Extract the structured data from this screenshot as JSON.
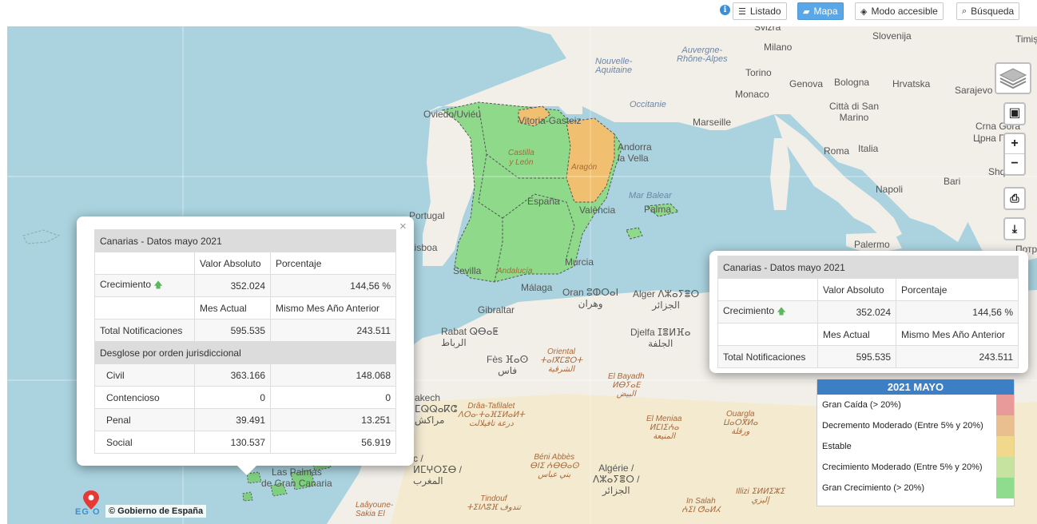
{
  "toolbar": {
    "info_glyph": "i",
    "listado": "Listado",
    "mapa": "Mapa",
    "modo_accesible": "Modo accesible",
    "busqueda": "Búsqueda"
  },
  "map_labels": {
    "suiza": "Svizra",
    "milano": "Milano",
    "slovenija": "Slovenija",
    "timisoara": "Timiș",
    "auvergne": "Auvergne-\nRhône-Alpes",
    "nouvelle": "Nouvelle-\nAquitaine",
    "torino": "Torino",
    "genova": "Genova",
    "bologna": "Bologna",
    "hrvatska": "Hrvatska",
    "sarajevo": "Sarajevo",
    "monaco": "Monaco",
    "occitanie": "Occitanie",
    "marseille": "Marseille",
    "citta_sm": "Città di San\nMarino",
    "crna_gora": "Crna Gora",
    "crna_cyr": "Црна Го",
    "oviedo": "Oviedo/Uviéu",
    "vitoria": "Vitoria-Gasteiz",
    "andorra": "Andorra\nla Vella",
    "roma": "Roma",
    "italia": "Italia",
    "castilla": "Castilla\ny León",
    "aragon": "Aragón",
    "bari": "Bari",
    "shqiperia": "Shqi",
    "napoli": "Napoli",
    "portugal": "Portugal",
    "espana": "España",
    "valencia": "València",
    "mar_balear": "Mar Balear",
    "palma": "Palma",
    "lisboa": "Lisboa",
    "palermo": "Palermo",
    "potpo": "Потро",
    "sevilla": "Sevilla",
    "andalucia": "Andalucía",
    "murcia": "Murcia",
    "malaga": "Málaga",
    "oran": "Oran ⵓⵀⵔⴰⵏ\nوهران",
    "alger": "Alger ⴷⵣⴰⵢⴻⵔ\nالجزائر",
    "gibraltar": "Gibraltar",
    "rabat": "Rabat ⵕⴱⴰⵟ\nالرباط",
    "djelfa": "Djelfa ⵊⴻⵍⴼⴰ\nالجلفة",
    "fes": "Fès ⴼⴰⵙ\nفاس",
    "oriental": "Oriental\nⵜⴰⵏⴳⵎⵓⵔⵜ\nالشرقية",
    "el_bayadh": "El Bayadh\nⵍⴱⵢⴰⴹ\nالبيض",
    "marrakech": "akech\nⵎⵕⵕⴰⴽⵛ\nمراكش",
    "draa": "Drâa-Tafilalet\nⴷⵔⴰ-ⵜⴰⴼⵉⵍⴰⵍⵜ\nدرعة تافيلالت",
    "el_meniaa": "El Meniaa\nⵍⵎⵏⵉⵄⴰ\nالمنيعة",
    "ouargla": "Ouargla\nⵡⴰⵔⴳⵍⴰ\nورقلة",
    "maroc": "c /\nⵍⵎⵖⵔⵉⴱ /\nالمغرب",
    "beni_abbes": "Béni Abbès\nⴱⵏⵉ ⵄⴱⴱⴰⵙ\nبني عباس",
    "algerie": "Algérie /\nⴷⵣⴰⵢⴻⵔ /\nالجزائر",
    "las_palmas": "Las Palmas\nde Gran Canaria",
    "tindouf": "Tindouf\nⵜⵉⵏⴷⵓⴼ تندوف",
    "illizi": "Illizi ⵉⵍⵍⵉⵣⵉ\nإليزي",
    "laayoune": "Laâyoune-\nSakia El",
    "in_salah": "In Salah\nⵄⵉⵏ ⵚⴰⵍⵃ"
  },
  "popup_left": {
    "title": "Canarias - Datos mayo 2021",
    "col_valor": "Valor Absoluto",
    "col_porcentaje": "Porcentaje",
    "crecimiento_label": "Crecimiento",
    "arrow": "🡅",
    "crecimiento_valor": "352.024",
    "crecimiento_pct": "144,56 %",
    "col_mes_actual": "Mes Actual",
    "col_mismo_mes": "Mismo Mes Año Anterior",
    "total_label": "Total Notificaciones",
    "total_actual": "595.535",
    "total_anterior": "243.511",
    "desglose_title": "Desglose por orden jurisdiccional",
    "rows": [
      {
        "label": "Civil",
        "actual": "363.166",
        "anterior": "148.068"
      },
      {
        "label": "Contencioso",
        "actual": "0",
        "anterior": "0"
      },
      {
        "label": "Penal",
        "actual": "39.491",
        "anterior": "13.251"
      },
      {
        "label": "Social",
        "actual": "130.537",
        "anterior": "56.919"
      }
    ],
    "close": "×"
  },
  "popup_right": {
    "title": "Canarias - Datos mayo 2021",
    "col_valor": "Valor Absoluto",
    "col_porcentaje": "Porcentaje",
    "crecimiento_label": "Crecimiento",
    "arrow": "🡅",
    "crecimiento_valor": "352.024",
    "crecimiento_pct": "144,56 %",
    "col_mes_actual": "Mes Actual",
    "col_mismo_mes": "Mismo Mes Año Anterior",
    "total_label": "Total Notificaciones",
    "total_actual": "595.535",
    "total_anterior": "243.511"
  },
  "controls": {
    "zoom_in": "+",
    "zoom_out": "−",
    "print": "⎙",
    "download": "⤓"
  },
  "legend": {
    "title": "2021 MAYO",
    "items": [
      {
        "label": "Gran Caída (> 20%)",
        "color": "#e89a9a"
      },
      {
        "label": "Decremento Moderado (Entre 5% y 20%)",
        "color": "#eabf90"
      },
      {
        "label": "Estable",
        "color": "#f0d98a"
      },
      {
        "label": "Crecimiento Moderado (Entre 5% y 20%)",
        "color": "#c6e3a0"
      },
      {
        "label": "Gran Crecimiento (> 20%)",
        "color": "#8fdc8f"
      }
    ]
  },
  "attribution": "© Gobierno de España",
  "logo_text": "EG O",
  "colors": {
    "region_green": "#8ed98a",
    "region_orange": "#f0c070",
    "sea": "#aad3df",
    "land": "#f2efe9",
    "desert": "#f4e8c4",
    "accent": "#5aa7e8",
    "legend_header": "#3d7fc4"
  }
}
